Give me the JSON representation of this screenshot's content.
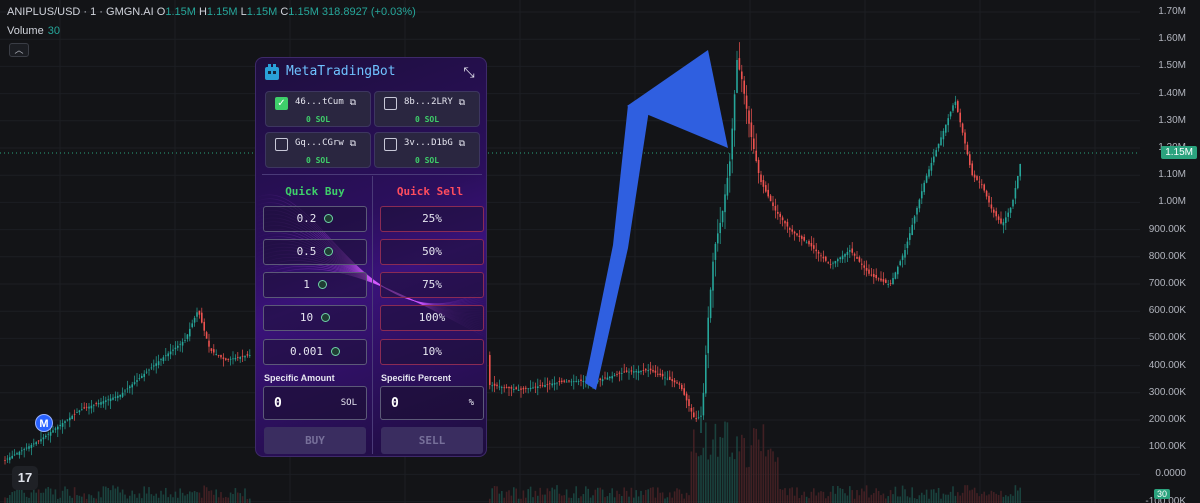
{
  "header": {
    "symbol": "ANIPLUS/USD · 1 · GMGN.AI",
    "open_label": "O",
    "open": "1.15M",
    "high_label": "H",
    "high": "1.15M",
    "low_label": "L",
    "low": "1.15M",
    "close_label": "C",
    "close": "1.15M",
    "change": "318.8927 (+0.03%)",
    "volume_label": "Volume",
    "volume_value": "30"
  },
  "price_axis": [
    "1.70M",
    "1.60M",
    "1.50M",
    "1.40M",
    "1.30M",
    "1.20M",
    "1.10M",
    "1.00M",
    "900.00K",
    "800.00K",
    "700.00K",
    "600.00K",
    "500.00K",
    "400.00K",
    "300.00K",
    "200.00K",
    "100.00K",
    "0.0000",
    "-100.00K"
  ],
  "current_price_tag": "1.15M",
  "volume_tag": "30",
  "badge_m": "M",
  "tv_logo": "17",
  "colors": {
    "up": "#26a69a",
    "down": "#ef5350",
    "arrow": "#2f5fe0",
    "background": "#131417"
  },
  "bot": {
    "title": "MetaTradingBot",
    "wallets": [
      {
        "address": "46...tCum",
        "balance": "0 SOL",
        "checked": true
      },
      {
        "address": "8b...2LRY",
        "balance": "0 SOL",
        "checked": false
      },
      {
        "address": "Gq...CGrw",
        "balance": "0 SOL",
        "checked": false
      },
      {
        "address": "3v...D1bG",
        "balance": "0 SOL",
        "checked": false
      }
    ],
    "quick_buy_label": "Quick Buy",
    "quick_sell_label": "Quick Sell",
    "buy_amounts": [
      "0.2",
      "0.5",
      "1",
      "10",
      "0.001"
    ],
    "sell_percents": [
      "25%",
      "50%",
      "75%",
      "100%",
      "10%"
    ],
    "specific_amount_label": "Specific Amount",
    "specific_percent_label": "Specific Percent",
    "amount_value": "0",
    "amount_unit": "SOL",
    "percent_value": "0",
    "percent_unit": "%",
    "buy_button": "BUY",
    "sell_button": "SELL"
  }
}
